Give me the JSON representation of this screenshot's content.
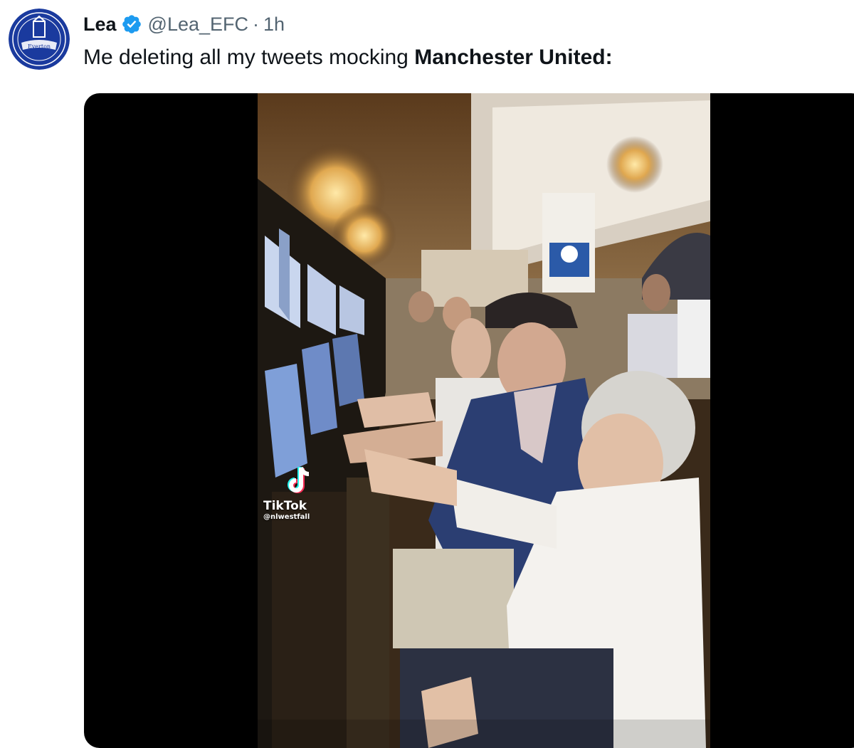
{
  "tweet": {
    "author": {
      "display_name": "Lea",
      "handle": "@Lea_EFC",
      "separator": "·",
      "timestamp": "1h",
      "avatar_text": "Everton",
      "verified": true
    },
    "text_prefix": "Me deleting all my tweets mocking ",
    "text_bold": "Manchester United:",
    "media": {
      "type": "video",
      "overlay": {
        "brand": "TikTok",
        "username": "@nlwestfall"
      }
    }
  },
  "colors": {
    "text_primary": "#0f1419",
    "text_secondary": "#536471",
    "verified_blue": "#1d9bf0",
    "media_background": "#000000",
    "avatar_blue": "#1a3a9e"
  },
  "icons": {
    "verified": "verified-badge-icon",
    "tiktok": "tiktok-logo-icon"
  }
}
